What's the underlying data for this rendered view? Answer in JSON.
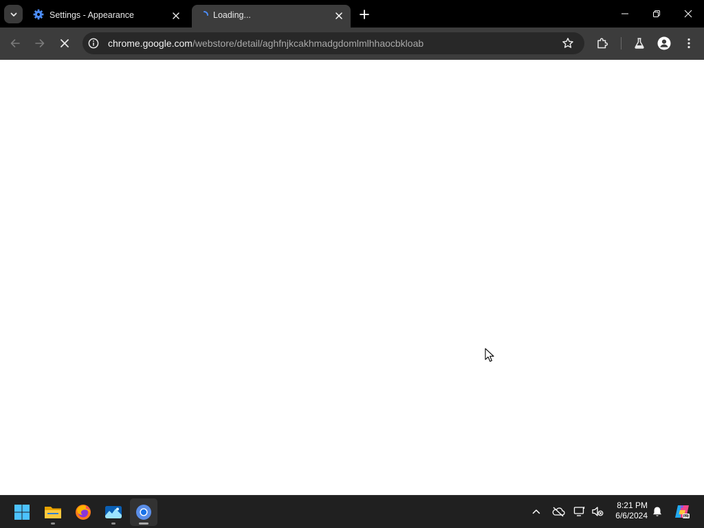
{
  "browser": {
    "tabs": [
      {
        "title": "Settings - Appearance",
        "icon": "gear-icon",
        "active": false
      },
      {
        "title": "Loading...",
        "icon": "loading-spinner-icon",
        "active": true
      }
    ],
    "omnibox": {
      "url_host": "chrome.google.com",
      "url_path": "/webstore/detail/aghfnjkcakhmadgdomlmlhhaocbkloab"
    },
    "colors": {
      "tabstrip": "#000000",
      "toolbar": "#3c3c3c",
      "omnibox": "#282828",
      "accent": "#4c8dfc"
    }
  },
  "taskbar": {
    "apps": [
      "windows-start-icon",
      "file-explorer-icon",
      "firefox-icon",
      "photos-icon",
      "chrome-icon"
    ],
    "clock": {
      "time": "8:21 PM",
      "date": "6/6/2024"
    },
    "tray": [
      "chevron-up-icon",
      "onedrive-icon",
      "network-icon",
      "volume-muted-icon",
      "bell-icon",
      "copilot-icon"
    ]
  }
}
